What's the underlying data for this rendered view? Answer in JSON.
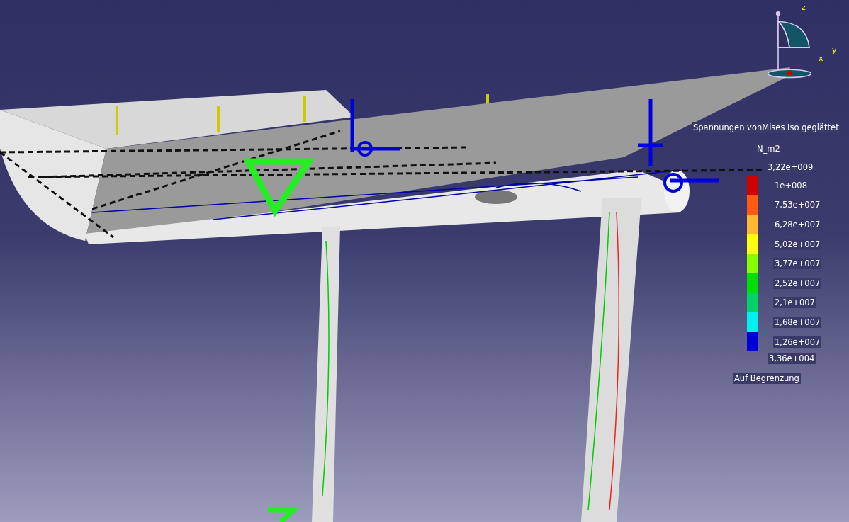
{
  "compass": {
    "axes": [
      "z",
      "y",
      "x"
    ]
  },
  "legend": {
    "title": "Spannungen vonMises Iso geglättet",
    "unit": "N_m2",
    "max": "3,22e+009",
    "bands": [
      {
        "label": "1e+008",
        "color": "#d00000"
      },
      {
        "label": "7,53e+007",
        "color": "#ff5a10"
      },
      {
        "label": "6,28e+007",
        "color": "#ffb830"
      },
      {
        "label": "5,02e+007",
        "color": "#ffff10"
      },
      {
        "label": "3,77e+007",
        "color": "#88ff00"
      },
      {
        "label": "2,52e+007",
        "color": "#00e000"
      },
      {
        "label": "2,1e+007",
        "color": "#00d468"
      },
      {
        "label": "1,68e+007",
        "color": "#00f0f0"
      },
      {
        "label": "1,26e+007",
        "color": "#0000d8"
      }
    ],
    "min": "3,36e+004",
    "footer": "Auf Begrenzung"
  }
}
